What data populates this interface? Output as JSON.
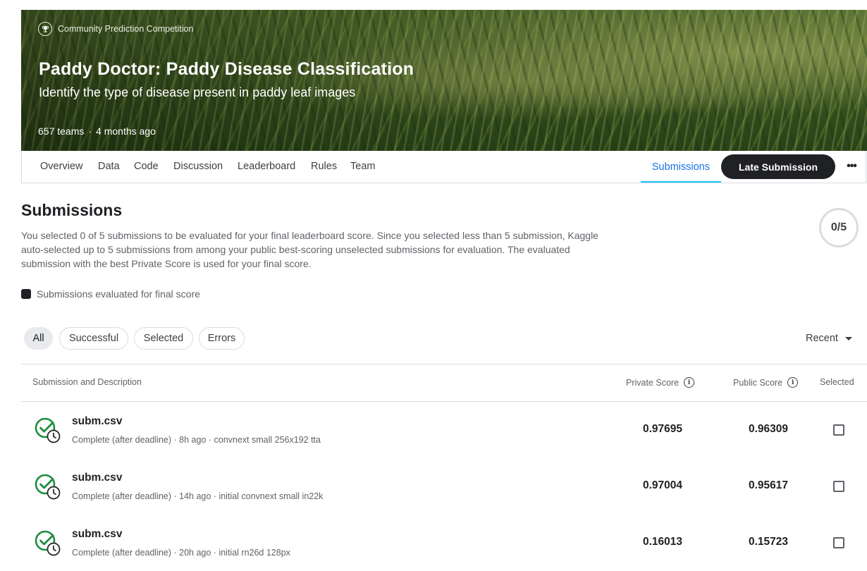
{
  "competition": {
    "type_label": "Community Prediction Competition",
    "title": "Paddy Doctor: Paddy Disease Classification",
    "subtitle": "Identify the type of disease present in paddy leaf images",
    "teams": "657 teams",
    "separator": "·",
    "age": "4 months ago"
  },
  "tabs": [
    "Overview",
    "Data",
    "Code",
    "Discussion",
    "Leaderboard",
    "Rules",
    "Team"
  ],
  "active_tab": "Submissions",
  "late_submission_label": "Late Submission",
  "more_label": "•••",
  "submissions": {
    "title": "Submissions",
    "description": "You selected 0 of 5 submissions to be evaluated for your final leaderboard score. Since you selected less than 5 submission, Kaggle auto-selected up to 5 submissions from among your public best-scoring unselected submissions for evaluation. The evaluated submission with the best Private Score is used for your final score.",
    "selected_count": "0/5",
    "legend_label": "Submissions evaluated for final score"
  },
  "filters": [
    "All",
    "Successful",
    "Selected",
    "Errors"
  ],
  "active_filter": "All",
  "sort_label": "Recent",
  "table": {
    "columns": {
      "description": "Submission and Description",
      "private": "Private Score",
      "public": "Public Score",
      "selected": "Selected"
    },
    "rows": [
      {
        "file": "subm.csv",
        "meta": "Complete (after deadline) · 8h ago · convnext small 256x192 tta",
        "private": "0.97695",
        "public": "0.96309",
        "selected": false
      },
      {
        "file": "subm.csv",
        "meta": "Complete (after deadline) · 14h ago · initial convnext small in22k",
        "private": "0.97004",
        "public": "0.95617",
        "selected": false
      },
      {
        "file": "subm.csv",
        "meta": "Complete (after deadline) · 20h ago · initial rn26d 128px",
        "private": "0.16013",
        "public": "0.15723",
        "selected": false
      }
    ]
  },
  "colors": {
    "success_green": "#1e8e3e",
    "active_tab_underline": "#20beff",
    "dark_button": "#202124"
  }
}
